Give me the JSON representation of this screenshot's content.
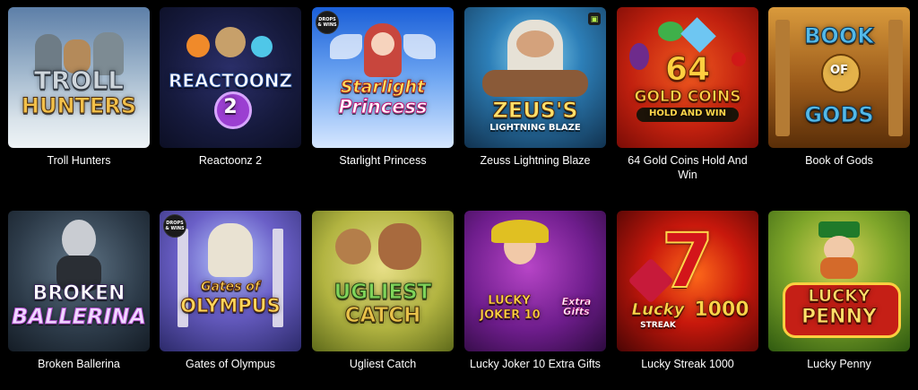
{
  "games": [
    {
      "title": "Troll Hunters",
      "logo": [
        "TROLL",
        "HUNTERS"
      ]
    },
    {
      "title": "Reactoonz 2",
      "logo": [
        "REACTOONZ",
        "2"
      ]
    },
    {
      "title": "Starlight Princess",
      "logo": [
        "Starlight",
        "Princess"
      ],
      "badge": "DROPS & WINS"
    },
    {
      "title": "Zeuss Lightning Blaze",
      "logo": [
        "ZEUS'S",
        "LIGHTNING BLAZE"
      ]
    },
    {
      "title": "64 Gold Coins Hold And Win",
      "logo": [
        "64",
        "GOLD COINS",
        "HOLD AND WIN"
      ]
    },
    {
      "title": "Book of Gods",
      "logo": [
        "BOOK",
        "OF",
        "GODS"
      ]
    },
    {
      "title": "Broken Ballerina",
      "logo": [
        "BROKEN",
        "BALLERINA"
      ]
    },
    {
      "title": "Gates of Olympus",
      "logo": [
        "Gates of",
        "OLYMPUS"
      ],
      "badge": "DROPS & WINS"
    },
    {
      "title": "Ugliest Catch",
      "logo": [
        "UGLIEST",
        "CATCH"
      ]
    },
    {
      "title": "Lucky Joker 10 Extra Gifts",
      "logo": [
        "LUCKY",
        "JOKER 10",
        "Extra Gifts"
      ]
    },
    {
      "title": "Lucky Streak 1000",
      "logo": [
        "7",
        "Lucky",
        "1000",
        "STREAK"
      ]
    },
    {
      "title": "Lucky Penny",
      "logo": [
        "LUCKY",
        "PENNY"
      ]
    }
  ]
}
